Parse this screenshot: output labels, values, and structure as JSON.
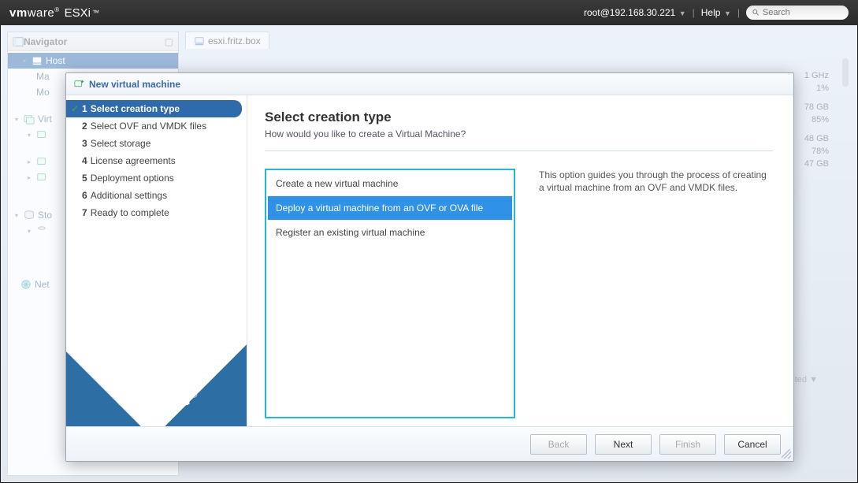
{
  "topbar": {
    "brand": "vmware",
    "product": "ESXi",
    "user": "root@192.168.30.221",
    "help": "Help",
    "search_placeholder": "Search"
  },
  "navigator": {
    "title": "Navigator",
    "host_label": "Host",
    "host_manage": "Ma",
    "host_monitor": "Mo",
    "virtual_machines": "Virt",
    "storage": "Sto",
    "networking": "Net"
  },
  "content": {
    "host_tab": "esxi.fritz.box"
  },
  "right_stats": {
    "cpu_ghz_a": "1 GHz",
    "cpu_pct": "1%",
    "mem_gb_a": "78 GB",
    "mem_pct": "85%",
    "stor_gb_a": "48 GB",
    "stor_pct": "78%",
    "stor_gb_b": "47 GB",
    "dropdown_label": "leted"
  },
  "modal": {
    "title": "New virtual machine",
    "steps": [
      "Select creation type",
      "Select OVF and VMDK files",
      "Select storage",
      "License agreements",
      "Deployment options",
      "Additional settings",
      "Ready to complete"
    ],
    "side_logo": "vmware",
    "heading": "Select creation type",
    "subtitle": "How would you like to create a Virtual Machine?",
    "options": [
      "Create a new virtual machine",
      "Deploy a virtual machine from an OVF or OVA file",
      "Register an existing virtual machine"
    ],
    "description": "This option guides you through the process of creating a virtual machine from an OVF and VMDK files.",
    "buttons": {
      "back": "Back",
      "next": "Next",
      "finish": "Finish",
      "cancel": "Cancel"
    }
  }
}
